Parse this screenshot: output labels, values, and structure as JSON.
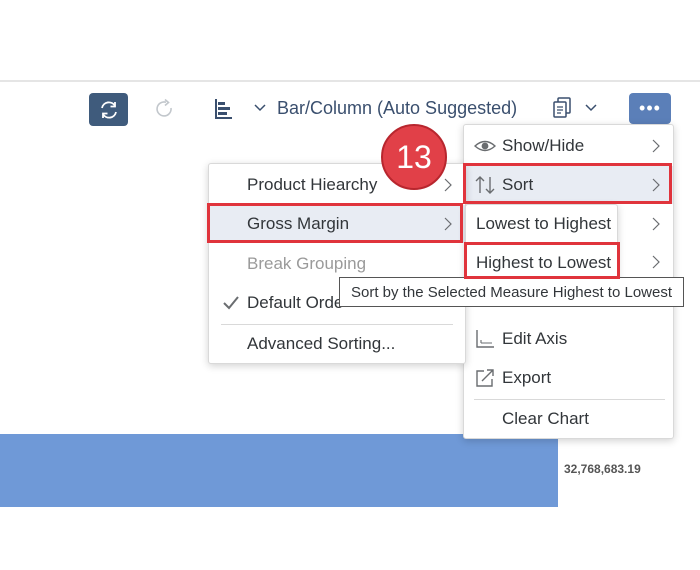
{
  "toolbar": {
    "refresh_icon": "refresh-icon",
    "redo_icon": "redo-icon",
    "chart_type_icon": "bar-chart-icon",
    "chart_type_label": "Bar/Column (Auto Suggested)",
    "copy_icon": "copy-icon",
    "more_label": "•••",
    "colors": {
      "refresh_bg": "#3f5b7c",
      "more_bg": "#5b7fb8",
      "label": "#3a4f6e"
    }
  },
  "step_badge": "13",
  "sort_dimension_menu": {
    "items": [
      {
        "label": "Product Hiearchy",
        "has_submenu": true
      },
      {
        "label": "Gross Margin",
        "has_submenu": true,
        "selected": true
      },
      {
        "label": "Break Grouping",
        "disabled": true
      },
      {
        "label": "Default Orde",
        "checked": true,
        "check_icon": "checkmark-icon"
      },
      {
        "label": "Advanced Sorting..."
      }
    ]
  },
  "chart_menu": {
    "items": [
      {
        "label": "Show/Hide",
        "icon": "eye-icon",
        "has_submenu": true
      },
      {
        "label": "Sort",
        "icon": "sort-icon",
        "has_submenu": true,
        "selected": true
      },
      {
        "label": "Edit Axis",
        "icon": "axis-icon"
      },
      {
        "label": "Export",
        "icon": "export-icon"
      },
      {
        "label": "Clear Chart"
      }
    ]
  },
  "sort_order_menu": {
    "items": [
      {
        "label": "Lowest to Highest"
      },
      {
        "label": "Highest to Lowest"
      }
    ]
  },
  "tooltip": "Sort by the Selected Measure Highest to Lowest",
  "chart": {
    "bar_value_label": "32,768,683.19",
    "bar_color": "#6f99d7"
  },
  "highlight_color": "#e0343c"
}
